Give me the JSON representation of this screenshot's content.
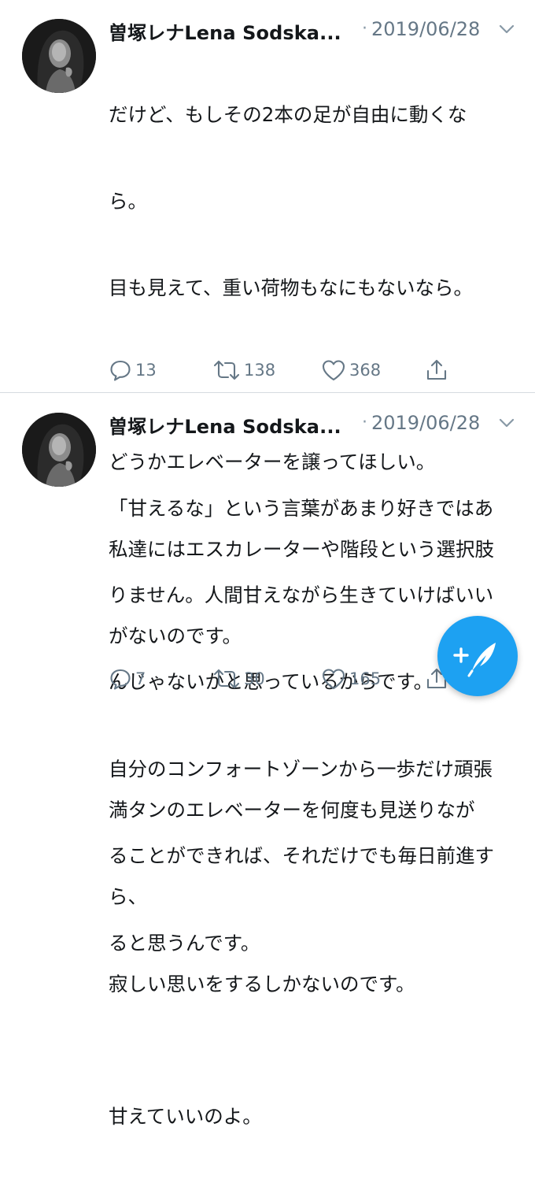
{
  "tweets": [
    {
      "author_name": "曽塚レナLena Sodska...",
      "separator": "·",
      "date": "2019/06/28",
      "body_lines": [
        "だけど、もしその2本の足が自由に動くな",
        "ら。",
        "目も見えて、重い荷物もなにもないなら。",
        "",
        "どうかエレベーターを譲ってほしい。",
        "私達にはエスカレーターや階段という選択肢",
        "がないのです。",
        "",
        "満タンのエレベーターを何度も見送りなが",
        "ら、",
        "寂しい思いをするしかないのです。"
      ],
      "reply_count": "13",
      "retweet_count": "138",
      "like_count": "368"
    },
    {
      "author_name": "曽塚レナLena Sodska...",
      "separator": "·",
      "date": "2019/06/28",
      "body_lines": [
        "「甘えるな」という言葉があまり好きではあ",
        "りません。人間甘えながら生きていけばいい",
        "んじゃないかと思っているからです。",
        "自分のコンフォートゾーンから一歩だけ頑張",
        "ることができれば、それだけでも毎日前進す",
        "ると思うんです。",
        "",
        "甘えていいのよ。"
      ],
      "reply_count": "7",
      "retweet_count": "30",
      "like_count": "165"
    }
  ],
  "icons": {
    "reply": "reply-icon",
    "retweet": "retweet-icon",
    "like": "heart-icon",
    "share": "share-icon",
    "more": "chevron-down-icon",
    "compose": "compose-tweet-icon"
  },
  "colors": {
    "text": "#14171a",
    "secondary": "#657786",
    "accent": "#1da1f2",
    "divider": "#d6dbe0"
  }
}
